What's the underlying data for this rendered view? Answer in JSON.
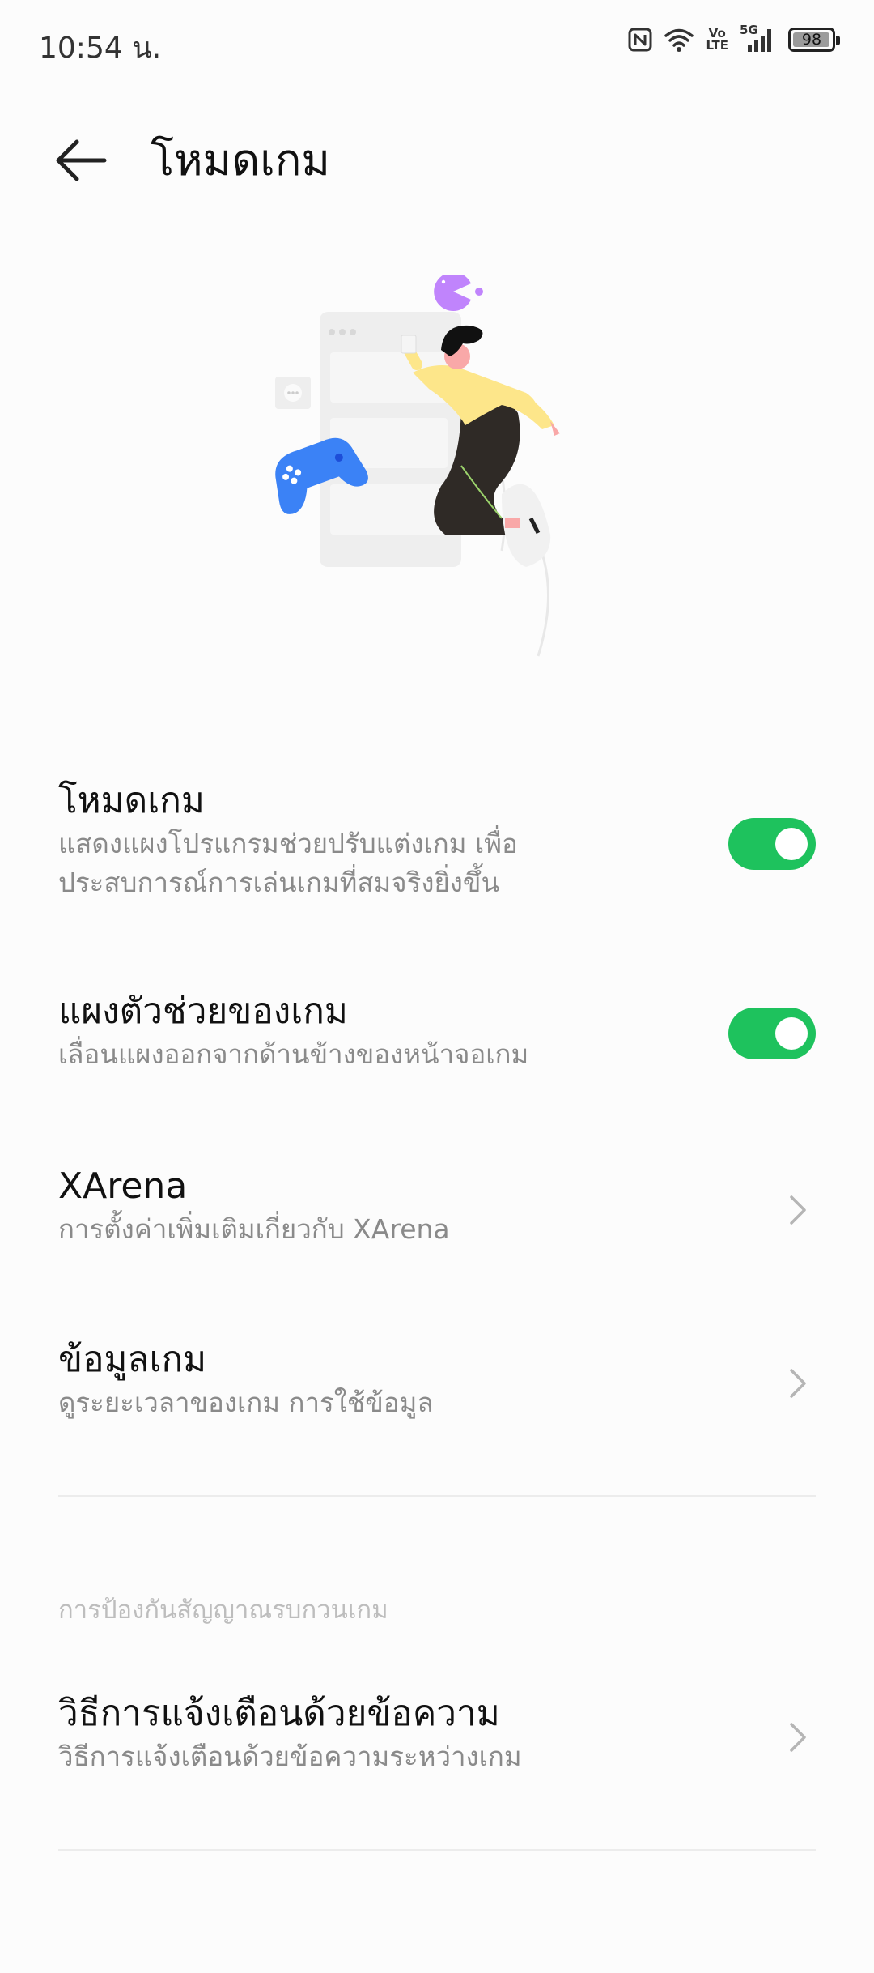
{
  "status_bar": {
    "time": "10:54 น.",
    "volte_top": "Vo",
    "volte_bottom": "LTE",
    "network": "5G",
    "battery": "98",
    "battery_level": 0.98,
    "icons": [
      "nfc-icon",
      "wifi-icon",
      "volte-icon",
      "signal-icon",
      "battery-icon"
    ]
  },
  "header": {
    "title": "โหมดเกม",
    "back_icon": "arrow-left-icon"
  },
  "settings": [
    {
      "title": "โหมดเกม",
      "desc_line1": "แสดงแผงโปรแกรมช่วยปรับแต่งเกม เพื่อ",
      "desc_line2": "ประสบการณ์การเล่นเกมที่สมจริงยิ่งขึ้น",
      "control": "toggle",
      "enabled": true
    },
    {
      "title": "แผงตัวช่วยของเกม",
      "desc": "เลื่อนแผงออกจากด้านข้างของหน้าจอเกม",
      "control": "toggle",
      "enabled": true
    },
    {
      "title": "XArena",
      "desc": "การตั้งค่าเพิ่มเติมเกี่ยวกับ XArena",
      "control": "chevron"
    },
    {
      "title": "ข้อมูลเกม",
      "desc": "ดูระยะเวลาของเกม การใช้ข้อมูล",
      "control": "chevron"
    }
  ],
  "section": {
    "header": "การป้องกันสัญญาณรบกวนเกม",
    "items": [
      {
        "title": "วิธีการแจ้งเตือนด้วยข้อความ",
        "desc": "วิธีการแจ้งเตือนด้วยข้อความระหว่างเกม",
        "control": "chevron"
      }
    ]
  },
  "colors": {
    "toggle_on": "#1ec25d",
    "gamepad": "#3b82f6",
    "shirt": "#fde68a",
    "pacman": "#c084fc"
  }
}
